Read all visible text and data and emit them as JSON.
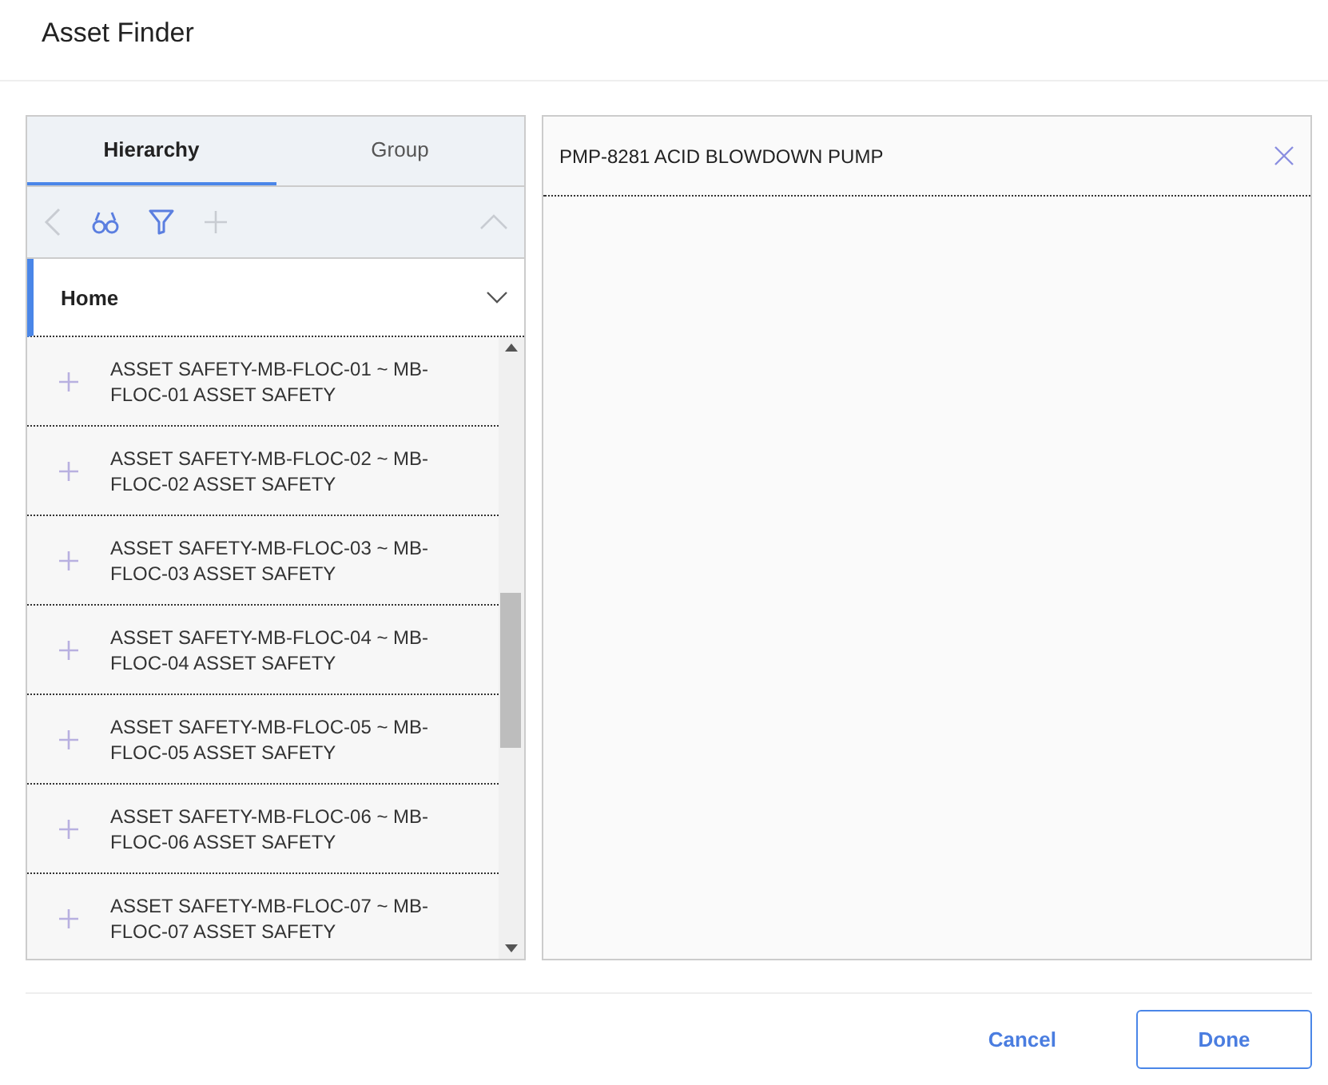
{
  "window": {
    "title": "Asset Finder"
  },
  "tabs": [
    {
      "label": "Hierarchy",
      "selected": true
    },
    {
      "label": "Group",
      "selected": false
    }
  ],
  "toolbar": [
    {
      "kind": "back",
      "disabled": true
    },
    {
      "kind": "search",
      "disabled": false
    },
    {
      "kind": "filter",
      "disabled": false
    },
    {
      "kind": "add",
      "disabled": true
    },
    {
      "kind": "collapse",
      "disabled": true
    }
  ],
  "home": {
    "label": "Home",
    "selected": true,
    "expanded": false
  },
  "items": [
    {
      "label": "ASSET SAFETY-MB-FLOC-01 ~ MB-FLOC-01 ASSET SAFETY"
    },
    {
      "label": "ASSET SAFETY-MB-FLOC-02 ~ MB-FLOC-02 ASSET SAFETY"
    },
    {
      "label": "ASSET SAFETY-MB-FLOC-03 ~ MB-FLOC-03 ASSET SAFETY"
    },
    {
      "label": "ASSET SAFETY-MB-FLOC-04 ~ MB-FLOC-04 ASSET SAFETY"
    },
    {
      "label": "ASSET SAFETY-MB-FLOC-05 ~ MB-FLOC-05 ASSET SAFETY"
    },
    {
      "label": "ASSET SAFETY-MB-FLOC-06 ~ MB-FLOC-06 ASSET SAFETY"
    },
    {
      "label": "ASSET SAFETY-MB-FLOC-07 ~ MB-FLOC-07 ASSET SAFETY"
    }
  ],
  "selection": [
    {
      "label": "PMP-8281 ACID BLOWDOWN PUMP"
    }
  ],
  "buttons": [
    {
      "label": "Cancel",
      "kind": "text"
    },
    {
      "label": "Done",
      "kind": "outline"
    }
  ]
}
